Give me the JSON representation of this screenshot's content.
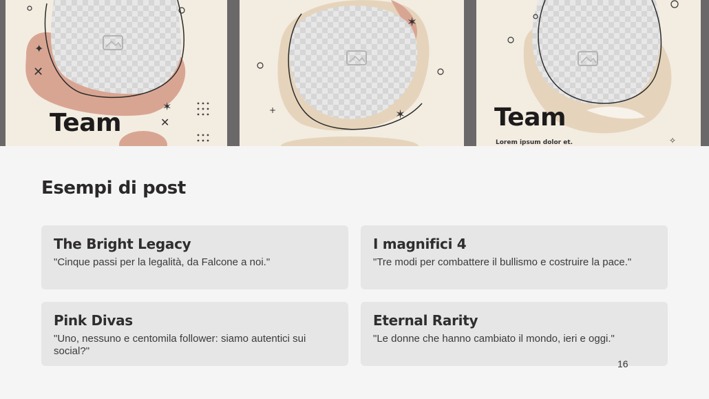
{
  "hero": {
    "posters": [
      {
        "title": "Team",
        "subtitle": ""
      },
      {
        "title": "",
        "subtitle": ""
      },
      {
        "title": "Team",
        "subtitle": "Lorem ipsum dolor et."
      }
    ]
  },
  "section": {
    "title": "Esempi di post"
  },
  "cards": [
    {
      "title": "The Bright Legacy",
      "text": "\"Cinque passi per la legalità, da Falcone a noi.\""
    },
    {
      "title": "I magnifici 4",
      "text": "\"Tre modi per combattere il bullismo e costruire la pace.\""
    },
    {
      "title": "Pink Divas",
      "text": "\"Uno, nessuno e centomila follower: siamo autentici sui social?\""
    },
    {
      "title": "Eternal Rarity",
      "text": "\"Le donne che hanno cambiato il mondo, ieri e oggi.\""
    }
  ],
  "page_number": "16",
  "icons": [
    "image-placeholder-icon"
  ],
  "colors": {
    "poster_bg": "#f3ece1",
    "accent_pink": "#d9a593",
    "accent_tan": "#e5d4bb",
    "card_bg": "#e6e6e6",
    "page_bg": "#f5f5f5"
  }
}
